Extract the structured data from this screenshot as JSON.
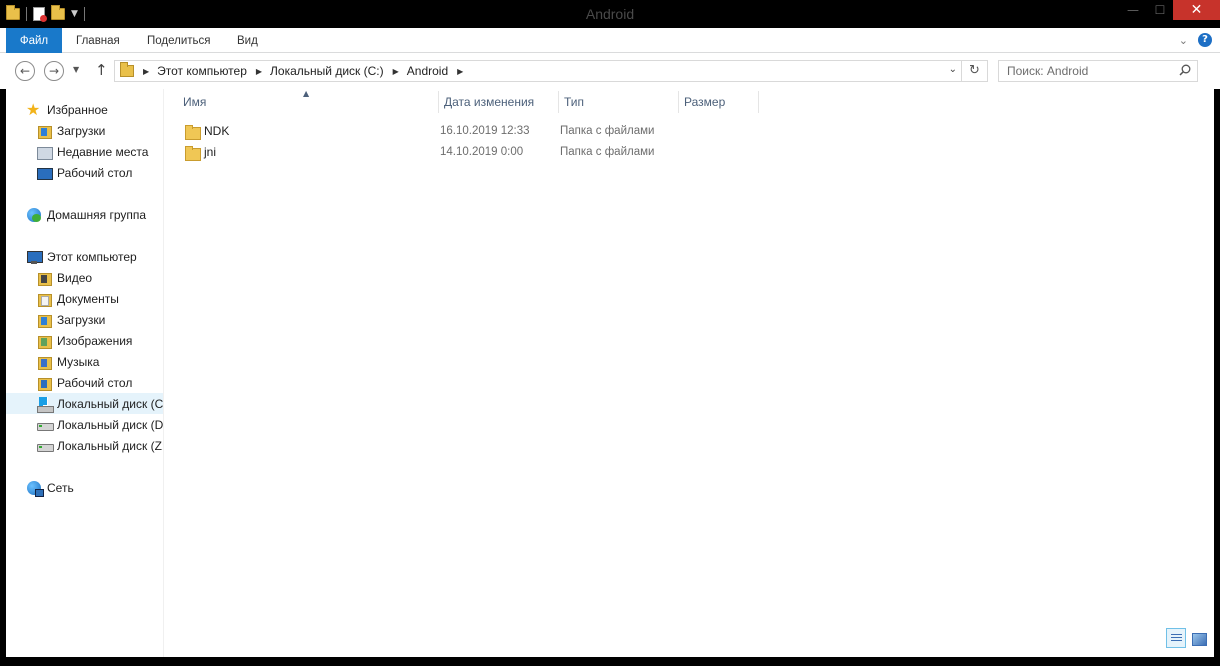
{
  "window": {
    "title": "Android"
  },
  "window_controls": {
    "minimize": "—",
    "maximize": "☐",
    "close": "✕"
  },
  "ribbon": {
    "tabs": [
      {
        "label": "Файл"
      },
      {
        "label": "Главная"
      },
      {
        "label": "Поделиться"
      },
      {
        "label": "Вид"
      }
    ],
    "help": "?"
  },
  "address": {
    "crumbs": [
      "Этот компьютер",
      "Локальный диск (C:)",
      "Android"
    ]
  },
  "search": {
    "placeholder": "Поиск: Android"
  },
  "sidebar": {
    "favorites": {
      "label": "Избранное",
      "items": [
        {
          "label": "Загрузки",
          "icon": "downloads-folder-icon"
        },
        {
          "label": "Недавние места",
          "icon": "recent-places-icon"
        },
        {
          "label": "Рабочий стол",
          "icon": "desktop-icon"
        }
      ]
    },
    "homegroup": {
      "label": "Домашняя группа"
    },
    "this_pc": {
      "label": "Этот компьютер",
      "items": [
        {
          "label": "Видео",
          "icon": "videos-folder-icon"
        },
        {
          "label": "Документы",
          "icon": "documents-folder-icon"
        },
        {
          "label": "Загрузки",
          "icon": "downloads-folder-icon"
        },
        {
          "label": "Изображения",
          "icon": "pictures-folder-icon"
        },
        {
          "label": "Музыка",
          "icon": "music-folder-icon"
        },
        {
          "label": "Рабочий стол",
          "icon": "desktop-folder-icon"
        },
        {
          "label": "Локальный диск (C:)",
          "icon": "windows-drive-icon",
          "selected": true
        },
        {
          "label": "Локальный диск (D:)",
          "icon": "drive-icon"
        },
        {
          "label": "Локальный диск (Z:)",
          "icon": "drive-icon"
        }
      ]
    },
    "network": {
      "label": "Сеть"
    }
  },
  "columns": {
    "name": "Имя",
    "date": "Дата изменения",
    "type": "Тип",
    "size": "Размер"
  },
  "files": [
    {
      "name": "NDK",
      "date": "16.10.2019 12:33",
      "type": "Папка с файлами"
    },
    {
      "name": "jni",
      "date": "14.10.2019 0:00",
      "type": "Папка с файлами"
    }
  ],
  "colors": {
    "file_tab": "#1979ca",
    "selection": "#e5f3fb",
    "close_button": "#c7332b",
    "folder": "#f0c755"
  }
}
